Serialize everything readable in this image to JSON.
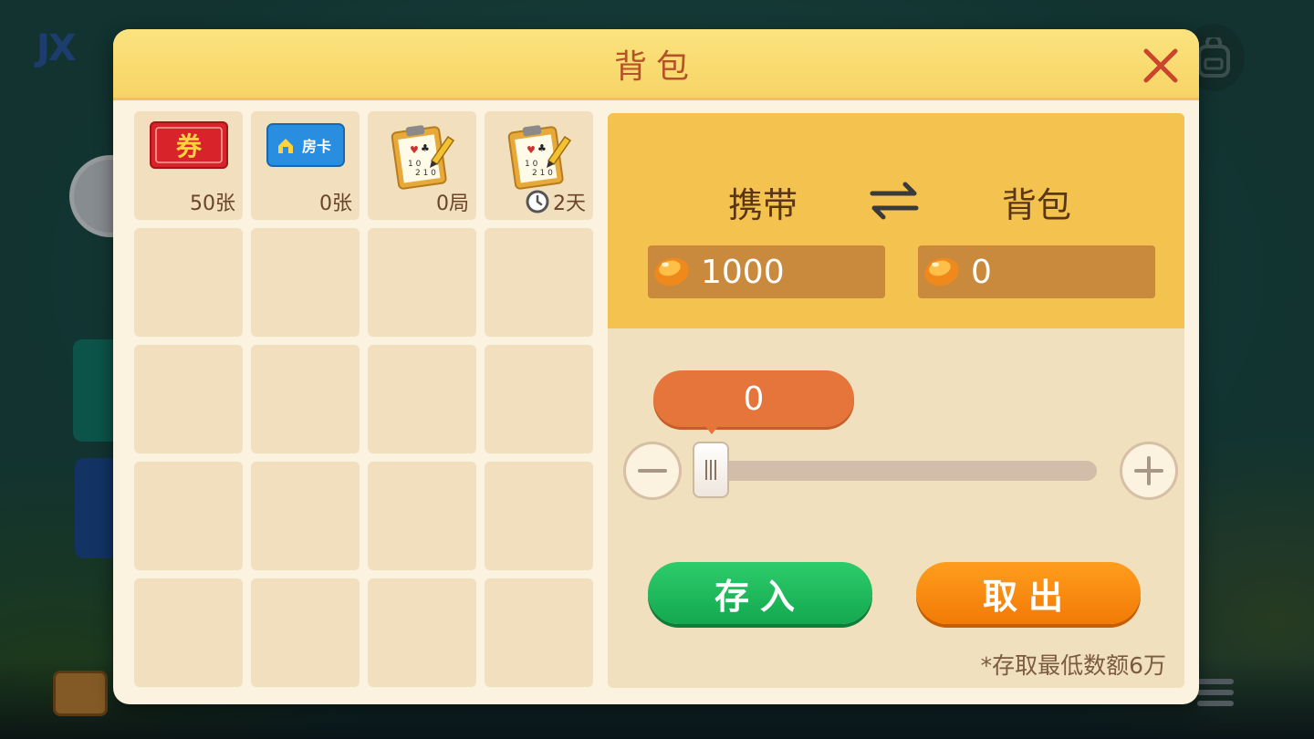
{
  "background": {
    "logo_text": "JX"
  },
  "modal": {
    "title": "背包",
    "close_icon": "close-x-icon"
  },
  "inventory": {
    "items": [
      {
        "name": "voucher",
        "icon": "voucher-ticket-icon",
        "badge_text": "券",
        "count": "50张"
      },
      {
        "name": "room-card",
        "icon": "room-card-icon",
        "badge_text": "房卡",
        "count": "0张"
      },
      {
        "name": "score-sheet-rounds",
        "icon": "score-clipboard-icon",
        "count": "0局"
      },
      {
        "name": "score-sheet-days",
        "icon": "score-clipboard-icon",
        "count": "2天",
        "timer_icon": "clock-icon"
      }
    ],
    "empty_slots": 16
  },
  "transfer": {
    "carry_label": "携带",
    "bag_label": "背包",
    "carry_amount": "1000",
    "bag_amount": "0",
    "slider_value": "0",
    "deposit_label": "存入",
    "withdraw_label": "取出",
    "note": "*存取最低数额6万"
  },
  "colors": {
    "header": "#f7d466",
    "title": "#b6522a",
    "panel_top": "#f3c24f",
    "deposit": "#14a84f",
    "withdraw": "#f27a06",
    "bubble": "#e5753a"
  }
}
